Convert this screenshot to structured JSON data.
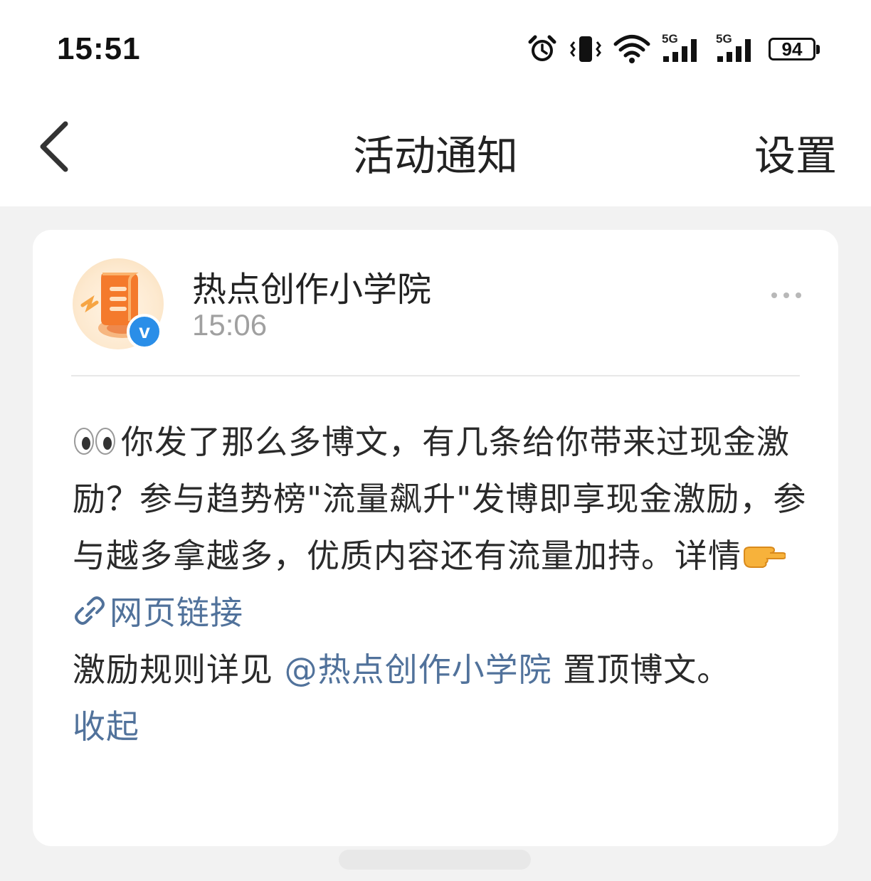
{
  "status_bar": {
    "time": "15:51",
    "network_1": "5G",
    "network_2": "5G",
    "battery": "94",
    "icons": [
      "alarm-icon",
      "vibrate-icon",
      "wifi-icon",
      "signal-icon",
      "signal-icon",
      "battery-icon"
    ]
  },
  "nav": {
    "title": "活动通知",
    "settings_label": "设置",
    "back_icon": "chevron-left-icon"
  },
  "card": {
    "author": "热点创作小学院",
    "time": "15:06",
    "verified_mark": "v",
    "more_icon": "ellipsis-icon",
    "body": {
      "line1": "你发了那么多博文，有几条给你带来过现金激励？参与趋势榜\"流量飙升\"发博即享现金激励，参与越多拿越多，优质内容还有流量加持。详情",
      "link_label": "网页链接",
      "rules_prefix": "激励规则详见 ",
      "mention": "@热点创作小学院",
      "rules_suffix": " 置顶博文。",
      "collapse_label": "收起"
    },
    "accent_color": "#51729b"
  }
}
